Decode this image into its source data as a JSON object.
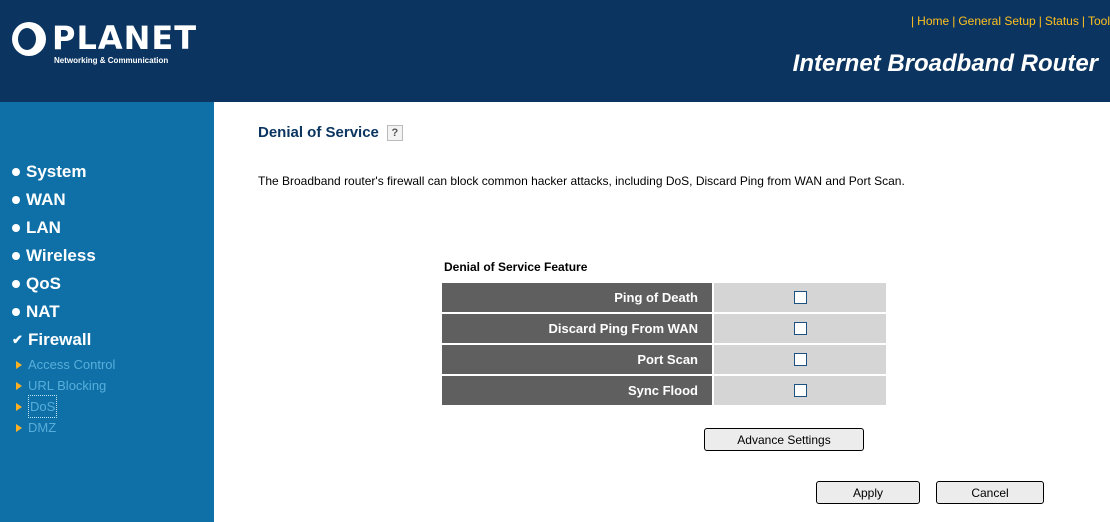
{
  "header": {
    "logo_text": "PLANET",
    "logo_subtitle": "Networking & Communication",
    "links": [
      {
        "label": "Home"
      },
      {
        "label": "General Setup"
      },
      {
        "label": "Status"
      },
      {
        "label": "Tool"
      }
    ],
    "title": "Internet Broadband Router"
  },
  "sidebar": {
    "items": [
      {
        "label": "System"
      },
      {
        "label": "WAN"
      },
      {
        "label": "LAN"
      },
      {
        "label": "Wireless"
      },
      {
        "label": "QoS"
      },
      {
        "label": "NAT"
      },
      {
        "label": "Firewall"
      }
    ],
    "firewall_sub": [
      {
        "label": "Access Control"
      },
      {
        "label": "URL Blocking"
      },
      {
        "label": "DoS"
      },
      {
        "label": "DMZ"
      }
    ]
  },
  "main": {
    "title": "Denial of Service",
    "help_glyph": "?",
    "description": "The Broadband router's firewall can block common hacker attacks, including DoS, Discard Ping from WAN and Port Scan.",
    "feature_title": "Denial of Service Feature",
    "features": [
      {
        "label": "Ping of Death",
        "checked": false
      },
      {
        "label": "Discard Ping From WAN",
        "checked": false
      },
      {
        "label": "Port Scan",
        "checked": false
      },
      {
        "label": "Sync Flood",
        "checked": false
      }
    ],
    "advance_label": "Advance Settings",
    "apply_label": "Apply",
    "cancel_label": "Cancel"
  },
  "colors": {
    "header_bg": "#0b3560",
    "sidebar_bg": "#0f70a8",
    "link_color": "#ffc01f",
    "table_label_bg": "#5f5f5f",
    "table_value_bg": "#d5d5d5"
  }
}
